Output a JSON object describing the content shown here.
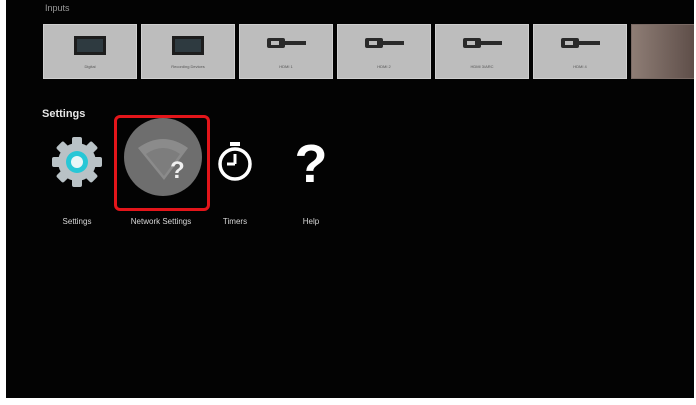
{
  "inputs": {
    "title": "Inputs",
    "tiles": [
      {
        "label": "Digital",
        "icon": "tv-icon"
      },
      {
        "label": "Recording Devices",
        "icon": "tv-icon"
      },
      {
        "label": "HDMI 1",
        "icon": "hdmi-cable-icon"
      },
      {
        "label": "HDMI 2",
        "icon": "hdmi-cable-icon"
      },
      {
        "label": "HDMI 3/ARC",
        "icon": "hdmi-cable-icon"
      },
      {
        "label": "HDMI 4",
        "icon": "hdmi-cable-icon"
      },
      {
        "label": "",
        "icon": "partial-tile"
      }
    ]
  },
  "settings": {
    "title": "Settings",
    "apps": [
      {
        "label": "Settings",
        "icon": "gear-icon"
      },
      {
        "label": "Network Settings",
        "icon": "network-help-icon",
        "focused": true
      },
      {
        "label": "Timers",
        "icon": "timer-icon"
      },
      {
        "label": "Help",
        "icon": "question-mark-icon"
      }
    ]
  },
  "colors": {
    "background": "#030303",
    "focus": "#e3151a",
    "gear_accent": "#27c7d6",
    "tile": "#bdbdbd"
  }
}
